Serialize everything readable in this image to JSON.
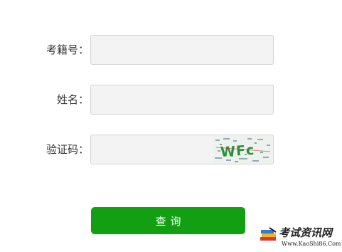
{
  "form": {
    "exam_number": {
      "label": "考籍号：",
      "value": "",
      "placeholder": ""
    },
    "name": {
      "label": "姓名：",
      "value": "",
      "placeholder": ""
    },
    "captcha": {
      "label": "验证码：",
      "value": "",
      "placeholder": "",
      "image_text": "WFc"
    }
  },
  "submit_label": "查询",
  "watermark": {
    "title": "考试资讯网",
    "site": "Www.KaoShi86.Com"
  },
  "colors": {
    "button": "#12a012",
    "field_bg": "#f3f3f3",
    "field_border": "#d4d4d4"
  }
}
